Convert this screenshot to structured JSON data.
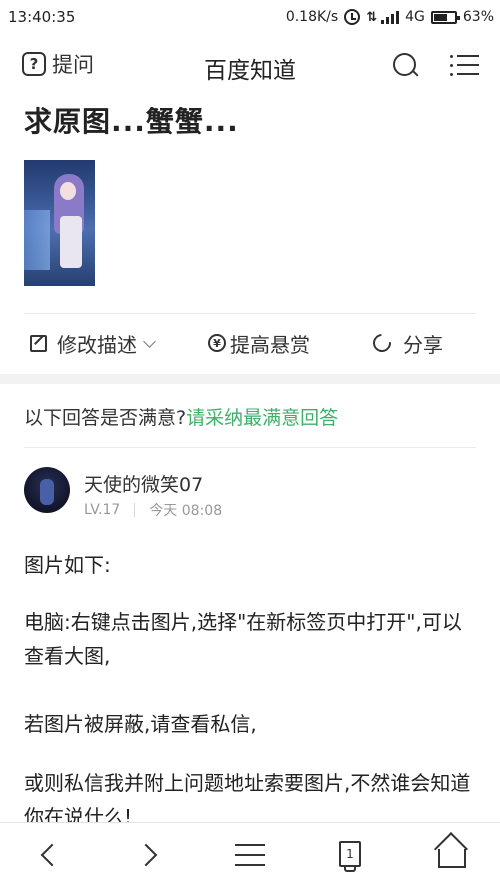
{
  "status_bar": {
    "time": "13:40:35",
    "speed": "0.18K/s",
    "network": "4G",
    "battery": "63%"
  },
  "nav": {
    "ask_label": "提问",
    "title": "百度知道"
  },
  "question": {
    "title": "求原图...蟹蟹..."
  },
  "actions": {
    "edit_label": "修改描述",
    "reward_label": "提高悬赏",
    "share_label": "分享"
  },
  "satisfaction": {
    "prompt": "以下回答是否满意?",
    "link": "请采纳最满意回答"
  },
  "answer": {
    "author": "天使的微笑07",
    "level": "LV.17",
    "time": "今天 08:08",
    "paragraphs": [
      "图片如下:",
      "电脑:右键点击图片,选择\"在新标签页中打开\",可以查看大图,",
      "若图片被屏蔽,请查看私信,",
      "或则私信我并附上问题地址索要图片,不然谁会知道你在说什么!"
    ]
  },
  "bottom_bar": {
    "tab_count": "1"
  }
}
